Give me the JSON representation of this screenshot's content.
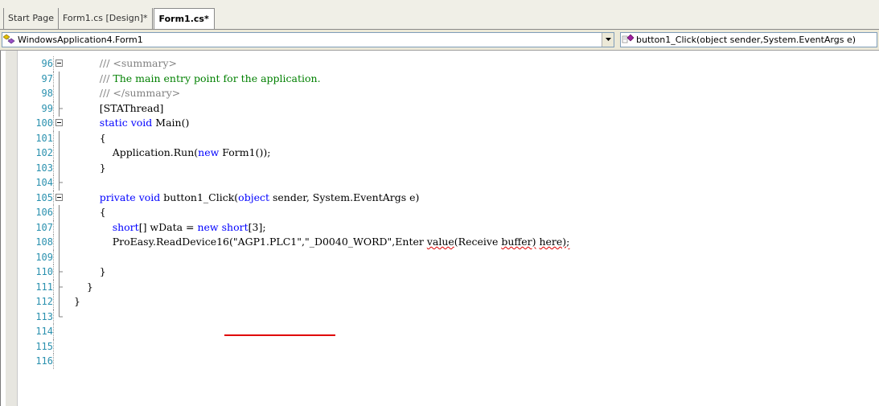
{
  "tabs": [
    "Start Page",
    "Form1.cs [Design]*",
    "Form1.cs*"
  ],
  "navigation": {
    "class_combo": "WindowsApplication4.Form1",
    "member_combo": "button1_Click(object sender,System.EventArgs e)"
  },
  "code_lines": [
    {
      "n": "96",
      "fold": "open",
      "indent": "        ",
      "parts": [
        {
          "t": "/// ",
          "c": "cmg"
        },
        {
          "t": "<summary>",
          "c": "cmg"
        }
      ]
    },
    {
      "n": "97",
      "fold": "line",
      "indent": "        ",
      "parts": [
        {
          "t": "/// ",
          "c": "cmg"
        },
        {
          "t": "The main entry point for the application.",
          "c": "cm"
        }
      ]
    },
    {
      "n": "98",
      "fold": "line",
      "indent": "        ",
      "parts": [
        {
          "t": "/// ",
          "c": "cmg"
        },
        {
          "t": "</summary>",
          "c": "cmg"
        }
      ]
    },
    {
      "n": "99",
      "fold": "end",
      "indent": "        ",
      "parts": [
        {
          "t": "[STAThread]",
          "c": ""
        }
      ]
    },
    {
      "n": "100",
      "fold": "open",
      "indent": "        ",
      "parts": [
        {
          "t": "static",
          "c": "kw"
        },
        {
          "t": " ",
          "c": ""
        },
        {
          "t": "void",
          "c": "kw"
        },
        {
          "t": " Main()",
          "c": ""
        }
      ]
    },
    {
      "n": "101",
      "fold": "line",
      "indent": "        ",
      "parts": [
        {
          "t": "{",
          "c": ""
        }
      ]
    },
    {
      "n": "102",
      "fold": "line",
      "indent": "            ",
      "parts": [
        {
          "t": "Application.Run(",
          "c": ""
        },
        {
          "t": "new",
          "c": "kw"
        },
        {
          "t": " Form1());",
          "c": ""
        }
      ]
    },
    {
      "n": "103",
      "fold": "line",
      "indent": "        ",
      "parts": [
        {
          "t": "}",
          "c": ""
        }
      ]
    },
    {
      "n": "104",
      "fold": "end",
      "indent": "",
      "parts": []
    },
    {
      "n": "105",
      "fold": "open",
      "indent": "        ",
      "parts": [
        {
          "t": "private",
          "c": "kw"
        },
        {
          "t": " ",
          "c": ""
        },
        {
          "t": "void",
          "c": "kw"
        },
        {
          "t": " button1_Click(",
          "c": ""
        },
        {
          "t": "object",
          "c": "kw"
        },
        {
          "t": " sender, System.EventArgs e)",
          "c": ""
        }
      ]
    },
    {
      "n": "106",
      "fold": "line",
      "indent": "        ",
      "parts": [
        {
          "t": "{",
          "c": ""
        }
      ]
    },
    {
      "n": "107",
      "fold": "line",
      "indent": "            ",
      "parts": [
        {
          "t": "short",
          "c": "kw"
        },
        {
          "t": "[] wData = ",
          "c": ""
        },
        {
          "t": "new",
          "c": "kw"
        },
        {
          "t": " ",
          "c": ""
        },
        {
          "t": "short",
          "c": "kw"
        },
        {
          "t": "[3];",
          "c": ""
        }
      ]
    },
    {
      "n": "108",
      "fold": "line",
      "indent": "            ",
      "parts": [
        {
          "t": "ProEasy.ReadDevice16(\"AGP1.PLC1\",\"_D0040_WORD\",Enter ",
          "c": ""
        },
        {
          "t": "value",
          "c": "sq"
        },
        {
          "t": "(Receive ",
          "c": ""
        },
        {
          "t": "buffer)",
          "c": "sq"
        },
        {
          "t": " ",
          "c": ""
        },
        {
          "t": "here);",
          "c": "sq"
        }
      ]
    },
    {
      "n": "109",
      "fold": "line",
      "indent": "",
      "parts": []
    },
    {
      "n": "110",
      "fold": "end",
      "indent": "        ",
      "parts": [
        {
          "t": "}",
          "c": ""
        }
      ]
    },
    {
      "n": "111",
      "fold": "end",
      "indent": "    ",
      "parts": [
        {
          "t": "}",
          "c": ""
        }
      ]
    },
    {
      "n": "112",
      "fold": "line",
      "indent": "",
      "parts": [
        {
          "t": "}",
          "c": ""
        }
      ]
    },
    {
      "n": "113",
      "fold": "last",
      "indent": "",
      "parts": []
    },
    {
      "n": "114",
      "fold": "none",
      "indent": "",
      "parts": []
    },
    {
      "n": "115",
      "fold": "none",
      "indent": "",
      "parts": []
    },
    {
      "n": "116",
      "fold": "none",
      "indent": "",
      "parts": []
    }
  ],
  "icons": {
    "class_icon": "class-icon",
    "member_icon": "method-icon",
    "dropdown": "chevron-down-icon"
  },
  "colors": {
    "keyword": "#0000ff",
    "comment": "#008000",
    "line_number": "#2b91af",
    "error_squiggle": "#e00000"
  }
}
